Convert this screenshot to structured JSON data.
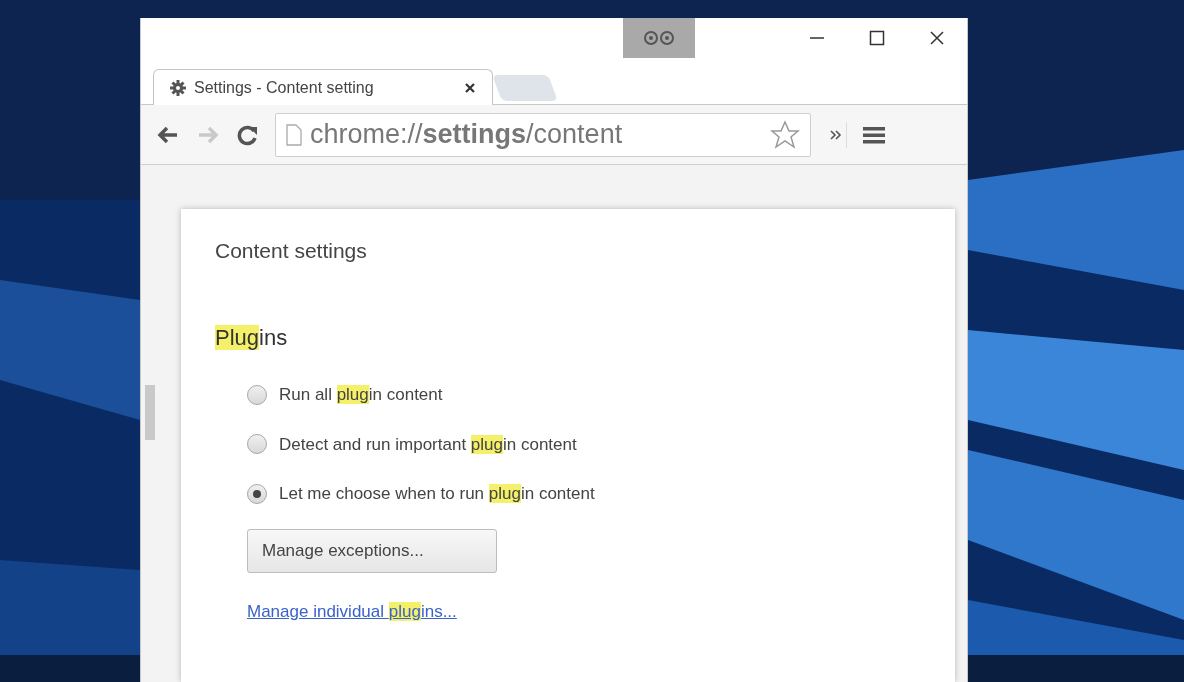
{
  "tabs": [
    {
      "title": "Settings - Content setting",
      "selected": true
    }
  ],
  "address_bar": {
    "url": "chrome://**settings**/content"
  },
  "page": {
    "heading": "Content settings",
    "section_title": [
      {
        "text": "Plug",
        "highlight": true
      },
      {
        "text": "ins",
        "highlight": false
      }
    ],
    "options": [
      {
        "selected": false,
        "label": [
          {
            "text": "Run all ",
            "highlight": false
          },
          {
            "text": "plug",
            "highlight": true
          },
          {
            "text": "in content",
            "highlight": false
          }
        ]
      },
      {
        "selected": false,
        "label": [
          {
            "text": "Detect and run important ",
            "highlight": false
          },
          {
            "text": "plug",
            "highlight": true
          },
          {
            "text": "in content",
            "highlight": false
          }
        ]
      },
      {
        "selected": true,
        "label": [
          {
            "text": "Let me choose when to run ",
            "highlight": false
          },
          {
            "text": "plug",
            "highlight": true
          },
          {
            "text": "in content",
            "highlight": false
          }
        ]
      }
    ],
    "button": "Manage exceptions...",
    "link": [
      {
        "text": "Manage individual ",
        "highlight": false
      },
      {
        "text": "plug",
        "highlight": true
      },
      {
        "text": "ins...",
        "highlight": false
      }
    ]
  }
}
